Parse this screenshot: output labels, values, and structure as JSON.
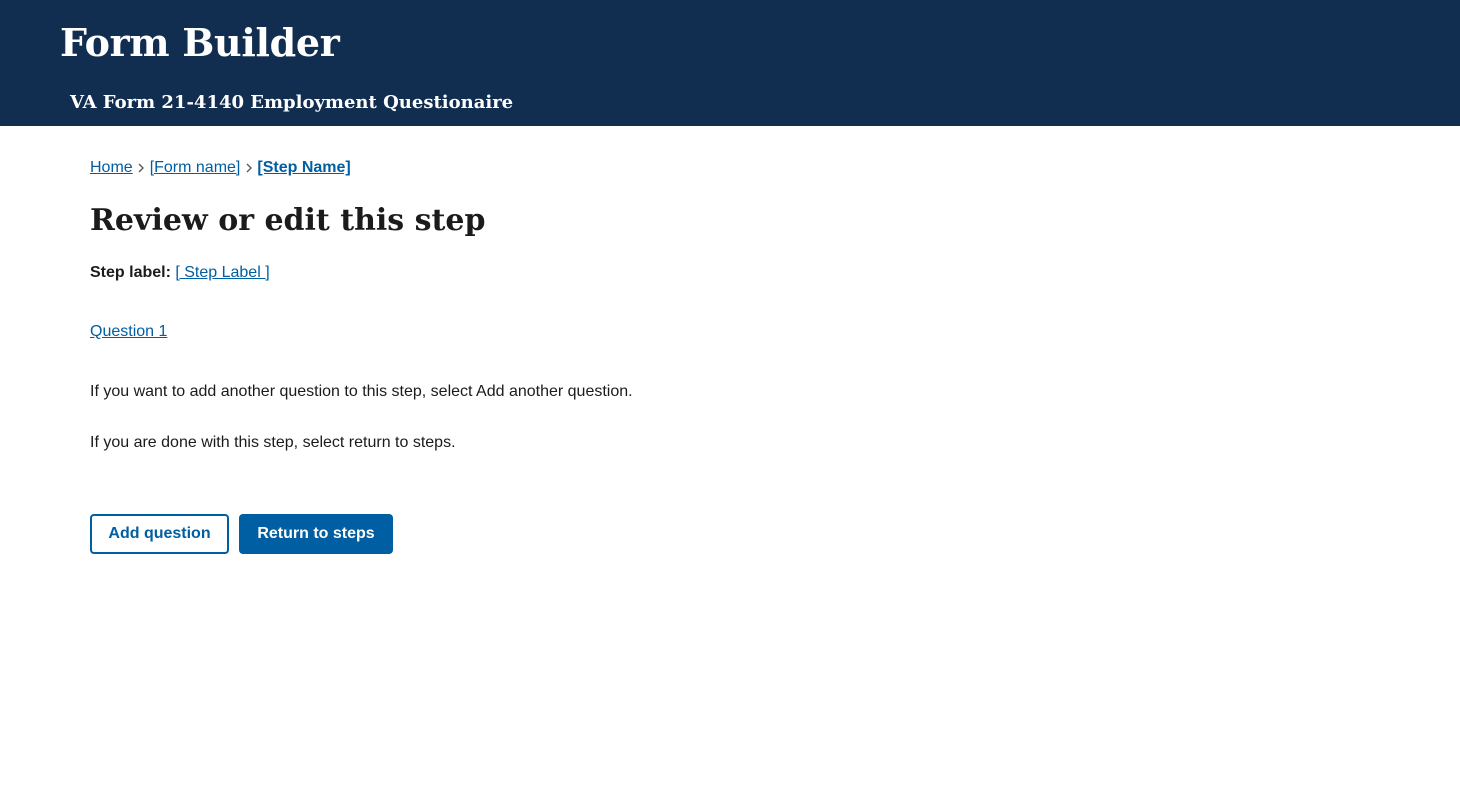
{
  "header": {
    "app_title": "Form Builder",
    "form_title": "VA Form 21-4140 Employment Questionaire"
  },
  "breadcrumb": {
    "items": [
      {
        "label": "Home"
      },
      {
        "label": "[Form name]"
      },
      {
        "label": "[Step Name]"
      }
    ],
    "separator_icon": "chevron-right-icon"
  },
  "main": {
    "title": "Review or edit this step",
    "step_label_key": "Step label:",
    "step_label_value": "[ Step Label ]",
    "questions": [
      {
        "label": "Question 1"
      }
    ],
    "help_add": "If you want to add another question to this step, select Add another question.",
    "help_done": "If you are done with this step, select return to steps."
  },
  "actions": {
    "add_question_label": "Add question",
    "return_label": "Return to steps"
  },
  "colors": {
    "header_bg": "#112e51",
    "link": "#005ea2",
    "primary_button": "#005ea2",
    "text": "#1b1b1b"
  }
}
